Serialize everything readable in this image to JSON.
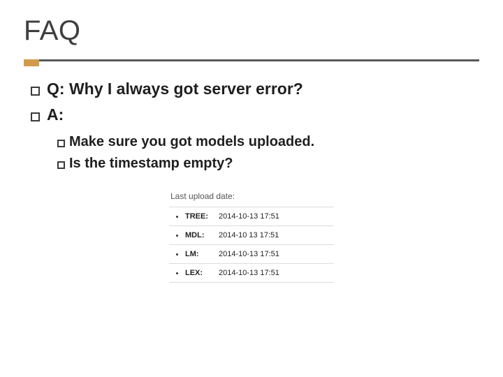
{
  "title": "FAQ",
  "bullets": {
    "q": "Q: Why I always got server error?",
    "a": "A:",
    "sub1": "Make sure you got models uploaded.",
    "sub2": "Is the timestamp empty?"
  },
  "figure": {
    "heading": "Last upload date:",
    "rows": [
      {
        "label": "TREE:",
        "value": "2014-10-13 17:51"
      },
      {
        "label": "MDL:",
        "value": "2014-10 13 17:51"
      },
      {
        "label": "LM:",
        "value": "2014-10-13 17:51"
      },
      {
        "label": "LEX:",
        "value": "2014-10-13 17:51"
      }
    ]
  }
}
